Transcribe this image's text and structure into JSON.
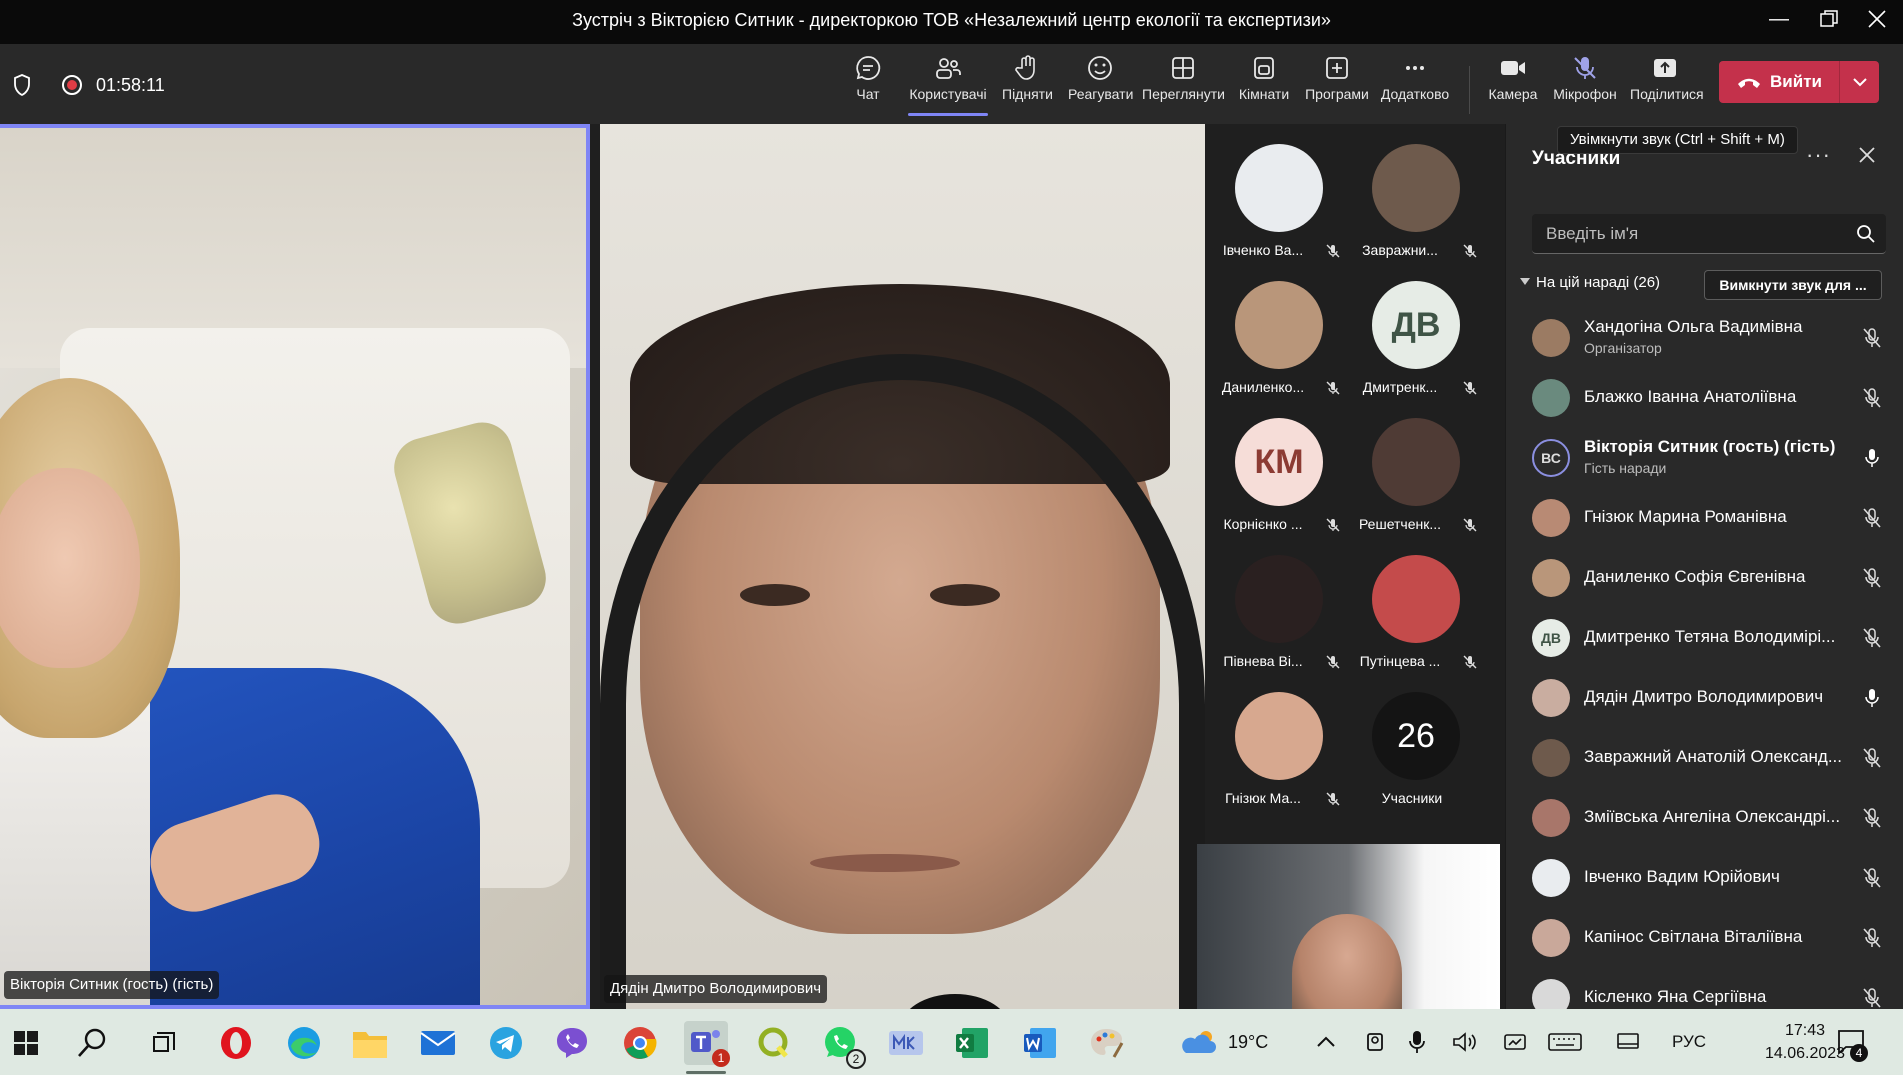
{
  "window": {
    "title": "Зустріч з Вікторією Ситник - директоркою ТОВ «Незалежний центр екології та експертизи»"
  },
  "toolbar": {
    "timer": "01:58:11",
    "buttons": {
      "chat": "Чат",
      "people": "Користувачі",
      "raise": "Підняти",
      "react": "Реагувати",
      "view": "Переглянути",
      "rooms": "Кімнати",
      "apps": "Програми",
      "more": "Додатково",
      "camera": "Камера",
      "mic": "Мікрофон",
      "share": "Поділитися"
    },
    "leave": "Вийти",
    "tooltip": "Увімкнути звук (Ctrl + Shift + M)"
  },
  "stage": {
    "left_name": "Вікторія Ситник (гость) (гість)",
    "mid_name": "Дядін Дмитро Володимирович"
  },
  "gallery": [
    {
      "name": "Івченко Ва...",
      "initials": "",
      "color": "#e9ecef"
    },
    {
      "name": "Завражни...",
      "initials": "",
      "color": "#6e5a4c"
    },
    {
      "name": "Даниленко...",
      "initials": "",
      "color": "#b9967a"
    },
    {
      "name": "Дмитренк...",
      "initials": "ДВ",
      "color": "#e6ece6",
      "text_color": "#3f5446"
    },
    {
      "name": "Корнієнко ...",
      "initials": "КМ",
      "color": "#f6ddd8",
      "text_color": "#8c3b33"
    },
    {
      "name": "Решетченк...",
      "initials": "",
      "color": "#4f3b35"
    },
    {
      "name": "Півнева Ві...",
      "initials": "",
      "color": "#2a2020"
    },
    {
      "name": "Путінцева ...",
      "initials": "",
      "color": "#c44b4b"
    },
    {
      "name": "Гнізюк Ма...",
      "initials": "",
      "color": "#d7a88f"
    },
    {
      "name": "Учасники",
      "initials": "26",
      "color": "#141414",
      "text_color": "#ffffff"
    }
  ],
  "panel": {
    "title": "Учасники",
    "search_placeholder": "Введіть ім'я",
    "meeting_label": "На цій нараді (26)",
    "mute_all": "Вимкнути звук для ...",
    "participants": [
      {
        "name": "Хандогіна Ольга Вадимівна",
        "role": "Організатор",
        "mic": "muted",
        "avatar": "#9b7b63",
        "initials": ""
      },
      {
        "name": "Блажко Іванна Анатоліївна",
        "role": "",
        "mic": "muted",
        "avatar": "#6a8a7e",
        "initials": ""
      },
      {
        "name": "Вікторія Ситник (гость) (гість)",
        "role": "Гість наради",
        "mic": "on",
        "avatar": "#2b2b2b",
        "initials": "ВС",
        "bold": true
      },
      {
        "name": "Гнізюк Марина Романівна",
        "role": "",
        "mic": "muted",
        "avatar": "#b88a74",
        "initials": ""
      },
      {
        "name": "Даниленко Софія Євгенівна",
        "role": "",
        "mic": "muted",
        "avatar": "#b9967a",
        "initials": ""
      },
      {
        "name": "Дмитренко Тетяна Володимірі...",
        "role": "",
        "mic": "muted",
        "avatar": "#e6ece6",
        "initials": "ДВ"
      },
      {
        "name": "Дядін Дмитро Володимирович",
        "role": "",
        "mic": "on",
        "avatar": "#c9ada0",
        "initials": ""
      },
      {
        "name": "Завражний Анатолій Олександ...",
        "role": "",
        "mic": "muted",
        "avatar": "#6e5a4c",
        "initials": ""
      },
      {
        "name": "Зміївська Ангеліна Олександрі...",
        "role": "",
        "mic": "muted",
        "avatar": "#a8766a",
        "initials": ""
      },
      {
        "name": "Івченко Вадим Юрійович",
        "role": "",
        "mic": "muted",
        "avatar": "#e9ecef",
        "initials": ""
      },
      {
        "name": "Капінос Світлана Віталіївна",
        "role": "",
        "mic": "muted",
        "avatar": "#c9a89a",
        "initials": ""
      },
      {
        "name": "Кісленко Яна Сергіївна",
        "role": "",
        "mic": "muted",
        "avatar": "#d9d9d9",
        "initials": ""
      }
    ]
  },
  "taskbar": {
    "weather": "19°C",
    "lang": "РУС",
    "time": "17:43",
    "date": "14.06.2023",
    "notifications": "4",
    "teams_badge": "1",
    "whatsapp_badge": "2"
  }
}
